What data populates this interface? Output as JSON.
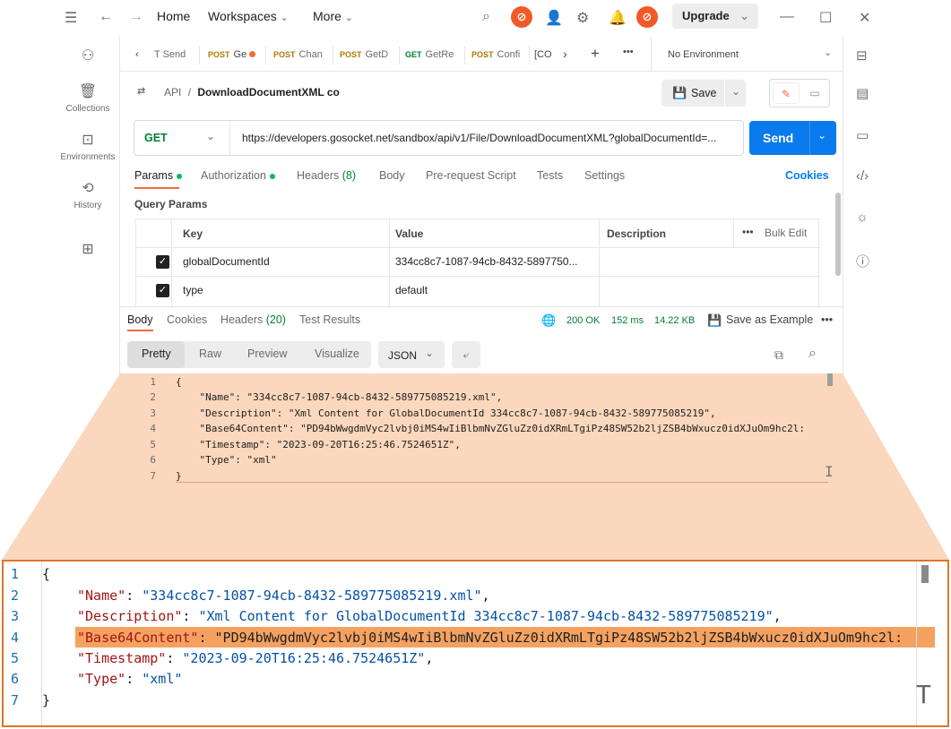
{
  "topbar": {
    "home": "Home",
    "workspaces": "Workspaces",
    "more": "More",
    "upgrade": "Upgrade"
  },
  "sidebar": {
    "items": [
      {
        "label": "",
        "icon": "team-icon"
      },
      {
        "label": "Collections",
        "icon": "collections-icon"
      },
      {
        "label": "Environments",
        "icon": "environments-icon"
      },
      {
        "label": "History",
        "icon": "history-icon"
      },
      {
        "label": "",
        "icon": "apps-icon"
      }
    ]
  },
  "tabs": {
    "items": [
      {
        "method": "",
        "name": "T Send"
      },
      {
        "method": "POST",
        "name": "Ge"
      },
      {
        "method": "POST",
        "name": "Chan"
      },
      {
        "method": "POST",
        "name": "GetD"
      },
      {
        "method": "GET",
        "name": "GetRe"
      },
      {
        "method": "POST",
        "name": "Confi"
      },
      {
        "method": "",
        "name": "[CO"
      }
    ],
    "environment": "No Environment"
  },
  "request": {
    "breadcrumb_parent": "API",
    "breadcrumb_sep": "/",
    "title": "DownloadDocumentXML co",
    "save": "Save",
    "method": "GET",
    "url": "https://developers.gosocket.net/sandbox/api/v1/File/DownloadDocumentXML?globalDocumentId=...",
    "send": "Send"
  },
  "param_tabs": {
    "params": "Params",
    "authorization": "Authorization",
    "headers": "Headers",
    "headers_count": "(8)",
    "body": "Body",
    "prerequest": "Pre-request Script",
    "tests": "Tests",
    "settings": "Settings",
    "cookies": "Cookies"
  },
  "query_params": {
    "title": "Query Params",
    "columns": [
      "Key",
      "Value",
      "Description"
    ],
    "bulk_edit": "Bulk Edit",
    "rows": [
      {
        "key": "globalDocumentId",
        "value": "334cc8c7-1087-94cb-8432-5897750..."
      },
      {
        "key": "type",
        "value": "default"
      }
    ]
  },
  "response": {
    "tabs": {
      "body": "Body",
      "cookies": "Cookies",
      "headers": "Headers",
      "headers_count": "(20)",
      "test_results": "Test Results"
    },
    "status": "200 OK",
    "time": "152 ms",
    "size": "14.22 KB",
    "save_example": "Save as Example",
    "views": [
      "Pretty",
      "Raw",
      "Preview",
      "Visualize"
    ],
    "format": "JSON"
  },
  "code_small": {
    "lines": [
      "{",
      "    \"Name\": \"334cc8c7-1087-94cb-8432-589775085219.xml\",",
      "    \"Description\": \"Xml Content for GlobalDocumentId 334cc8c7-1087-94cb-8432-589775085219\",",
      "    \"Base64Content\": \"PD94bWwgdmVyc2lvbj0iMS4wIiBlbmNvZGluZz0idXRmLTgiPz48SW52b2ljZSB4bWxucz0idXJuOm9hc2l:",
      "    \"Timestamp\": \"2023-09-20T16:25:46.7524651Z\",",
      "    \"Type\": \"xml\"",
      "}"
    ]
  },
  "code_big": {
    "line_numbers": [
      "1",
      "2",
      "3",
      "4",
      "5",
      "6",
      "7"
    ],
    "open": "{",
    "close": "}",
    "name_key": "\"Name\"",
    "name_val": "\"334cc8c7-1087-94cb-8432-589775085219.xml\"",
    "desc_key": "\"Description\"",
    "desc_val": "\"Xml Content for GlobalDocumentId 334cc8c7-1087-94cb-8432-589775085219\"",
    "b64_key": "\"Base64Content\"",
    "b64_val": "\"PD94bWwgdmVyc2lvbj0iMS4wIiBlbmNvZGluZz0idXRmLTgiPz48SW52b2ljZSB4bWxucz0idXJuOm9hc2l:",
    "ts_key": "\"Timestamp\"",
    "ts_val": "\"2023-09-20T16:25:46.7524651Z\"",
    "type_key": "\"Type\"",
    "type_val": "\"xml\""
  },
  "colors": {
    "accent": "#097bed",
    "highlight": "#f5a261",
    "zoom_border": "#e0742a",
    "zoom_wedge": "#fad7bd"
  }
}
